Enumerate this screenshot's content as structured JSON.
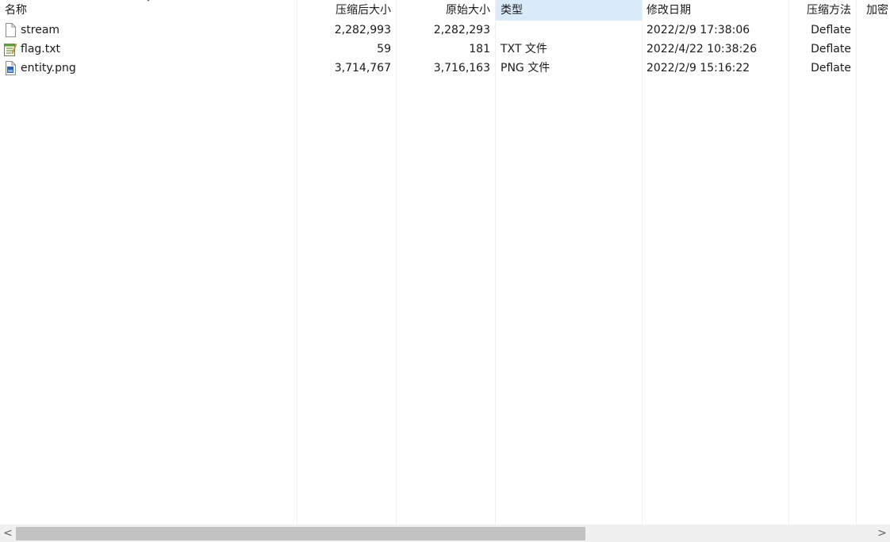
{
  "columns": {
    "name": "名称",
    "packed_size": "压缩后大小",
    "size": "原始大小",
    "type": "类型",
    "modified": "修改日期",
    "method": "压缩方法",
    "encrypted": "加密"
  },
  "files": [
    {
      "name": "stream",
      "icon": "blank-file-icon",
      "packed_size": "2,282,993",
      "size": "2,282,293",
      "type": "",
      "modified": "2022/2/9 17:38:06",
      "method": "Deflate"
    },
    {
      "name": "flag.txt",
      "icon": "text-file-icon",
      "packed_size": "59",
      "size": "181",
      "type": "TXT 文件",
      "modified": "2022/4/22 10:38:26",
      "method": "Deflate"
    },
    {
      "name": "entity.png",
      "icon": "image-file-icon",
      "packed_size": "3,714,767",
      "size": "3,716,163",
      "type": "PNG 文件",
      "modified": "2022/2/9 15:16:22",
      "method": "Deflate"
    }
  ],
  "scrollbar": {
    "left_arrow": "<",
    "right_arrow": ">"
  },
  "colors": {
    "active_header": "#d9ebf9",
    "separator": "#eef0f2",
    "scroll_thumb": "#c2c2c2"
  }
}
